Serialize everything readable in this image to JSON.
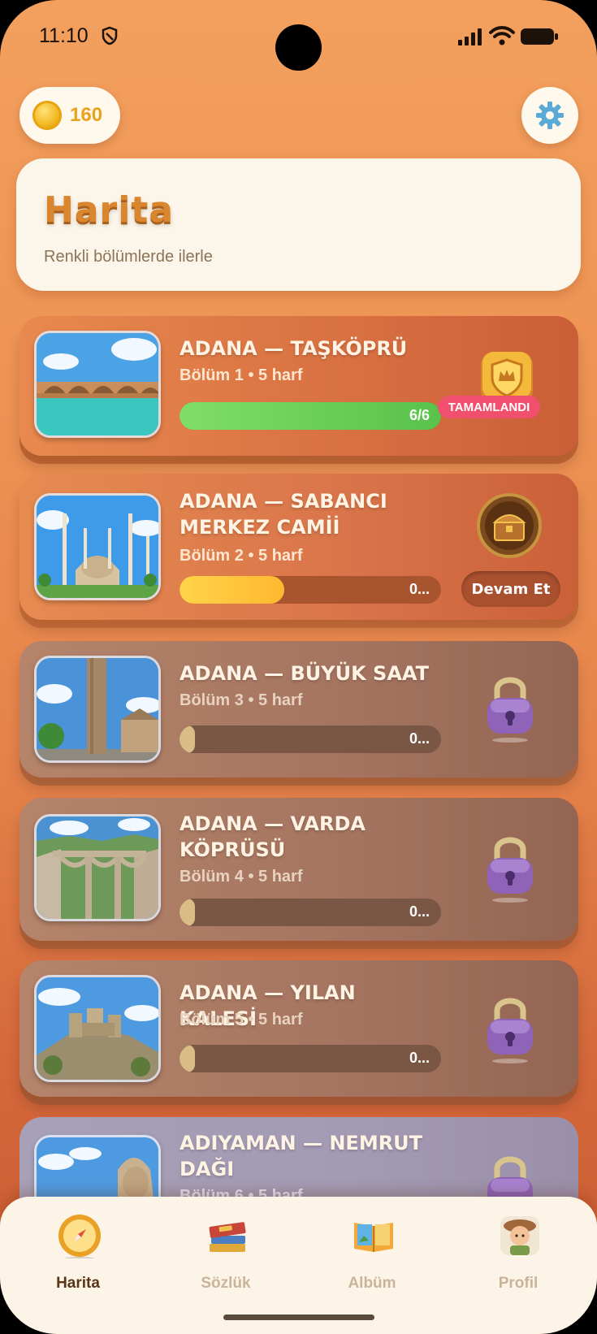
{
  "status_bar": {
    "time": "11:10"
  },
  "coins": {
    "count": "160"
  },
  "header": {
    "title": "Harita",
    "subtitle": "Renkli bölümlerde ilerle"
  },
  "levels": [
    {
      "title": "ADANA — TAŞKÖPRÜ",
      "subtitle": "Bölüm 1 • 5 harf",
      "progress_text": "6/6",
      "progress": 1.0,
      "state": "completed",
      "badge": "TAMAMLANDI",
      "icon": "crown-shield-icon"
    },
    {
      "title": "ADANA — SABANCI MERKEZ CAMİİ",
      "subtitle": "Bölüm 2 • 5 harf",
      "progress_text": "0...",
      "progress": 0.4,
      "state": "in-progress",
      "action": "Devam Et",
      "icon": "treasure-chest-icon"
    },
    {
      "title": "ADANA — BÜYÜK SAAT",
      "subtitle": "Bölüm 3 • 5 harf",
      "progress_text": "0...",
      "progress": 0.0,
      "state": "locked",
      "icon": "padlock-icon"
    },
    {
      "title": "ADANA — VARDA KÖPRÜSÜ",
      "subtitle": "Bölüm 4 • 5 harf",
      "progress_text": "0...",
      "progress": 0.0,
      "state": "locked",
      "icon": "padlock-icon"
    },
    {
      "title": "ADANA — YILAN KALESİ",
      "subtitle": "Bölüm 5 • 5 harf",
      "progress_text": "0...",
      "progress": 0.0,
      "state": "locked",
      "icon": "padlock-icon"
    },
    {
      "title": "ADIYAMAN — NEMRUT DAĞI",
      "subtitle": "Bölüm 6 • 5 harf",
      "progress_text": "",
      "progress": 0.0,
      "state": "locked",
      "icon": "padlock-icon"
    }
  ],
  "nav": [
    {
      "label": "Harita",
      "icon": "compass-icon",
      "active": true
    },
    {
      "label": "Sözlük",
      "icon": "dictionary-books-icon",
      "active": false
    },
    {
      "label": "Albüm",
      "icon": "photo-album-icon",
      "active": false
    },
    {
      "label": "Profil",
      "icon": "explorer-avatar-icon",
      "active": false
    }
  ],
  "colors": {
    "background_top": "#F3A05E",
    "background_bottom": "#C85A32",
    "coin": "#E9A21B",
    "progress_complete": "#6FD75A",
    "progress_active": "#FFC83A",
    "badge_completed": "#F0506E",
    "lock": "#8E63B8"
  }
}
